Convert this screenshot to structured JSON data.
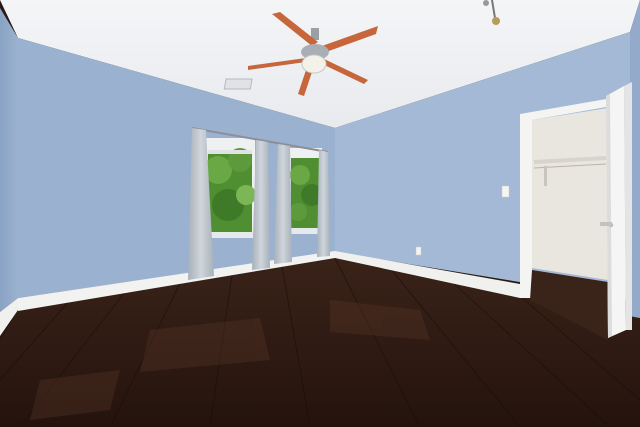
{
  "scene": {
    "kind": "empty-bedroom-photo",
    "colors": {
      "wall": "#9fb6d3",
      "wall_shadow": "#8ea7c8",
      "ceiling": "#f2f3f5",
      "baseboard": "#f2f2f0",
      "floor": "#3b241b",
      "floor_dark": "#22130e",
      "curtain": "#b9c0c8",
      "foliage": "#4f8f32",
      "fan_blade": "#c7663a",
      "door": "#f4f4f4"
    },
    "icons": [
      "ceiling-fan-icon",
      "window-icon",
      "door-icon",
      "closet-rod-icon",
      "light-switch-icon"
    ]
  }
}
